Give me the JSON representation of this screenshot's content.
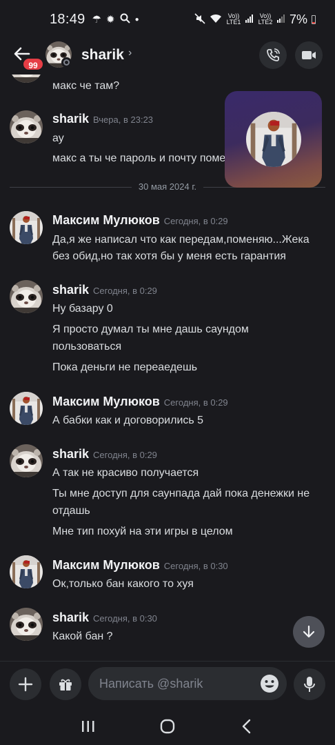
{
  "status_bar": {
    "time": "18:49",
    "left_icons": [
      "umbrella-icon",
      "sun-icon",
      "search-icon",
      "dot-icon"
    ],
    "sim1": "Vo)) LTE1",
    "sim2": "Vo)) LTE2",
    "battery": "7%"
  },
  "header": {
    "back_badge": "99",
    "title": "sharik",
    "chevron": "›"
  },
  "date_divider": "30 мая 2024 г.",
  "messages": [
    {
      "author": "",
      "time": "",
      "lines": [
        "макс че там?"
      ]
    },
    {
      "author": "sharik",
      "time": "Вчера, в 23:23",
      "lines": [
        "ау",
        "макс а ты че пароль и почту поменял?"
      ]
    },
    {
      "author": "Максим Мулюков",
      "time": "Сегодня, в 0:29",
      "lines": [
        "Да,я же написал что как передам,поменяю...Жека",
        "без обид,но так хотя бы у меня есть гарантия"
      ]
    },
    {
      "author": "sharik",
      "time": "Сегодня, в 0:29",
      "lines": [
        "Ну базару 0",
        "Я просто думал ты мне дашь саундом",
        "пользоваться",
        "Пока деньги не переаедешь"
      ]
    },
    {
      "author": "Максим Мулюков",
      "time": "Сегодня, в 0:29",
      "lines": [
        "А бабки как и договорились 5"
      ]
    },
    {
      "author": "sharik",
      "time": "Сегодня, в 0:29",
      "lines": [
        "А так не красиво получается",
        "Ты мне доступ для саунпада дай пока денежки не",
        "отдашь",
        "Мне тип похуй на эти игры в целом"
      ]
    },
    {
      "author": "Максим Мулюков",
      "time": "Сегодня, в 0:30",
      "lines": [
        "Ок,только бан какого то хуя"
      ]
    },
    {
      "author": "sharik",
      "time": "Сегодня, в 0:30",
      "lines": [
        "Какой бан ?"
      ]
    }
  ],
  "input": {
    "placeholder": "Написать @sharik"
  },
  "colors": {
    "background": "#1a1a1e",
    "surface": "#2b2d31",
    "badge": "#e53d45",
    "text": "#dbdee1",
    "timestamp": "#80848e"
  }
}
